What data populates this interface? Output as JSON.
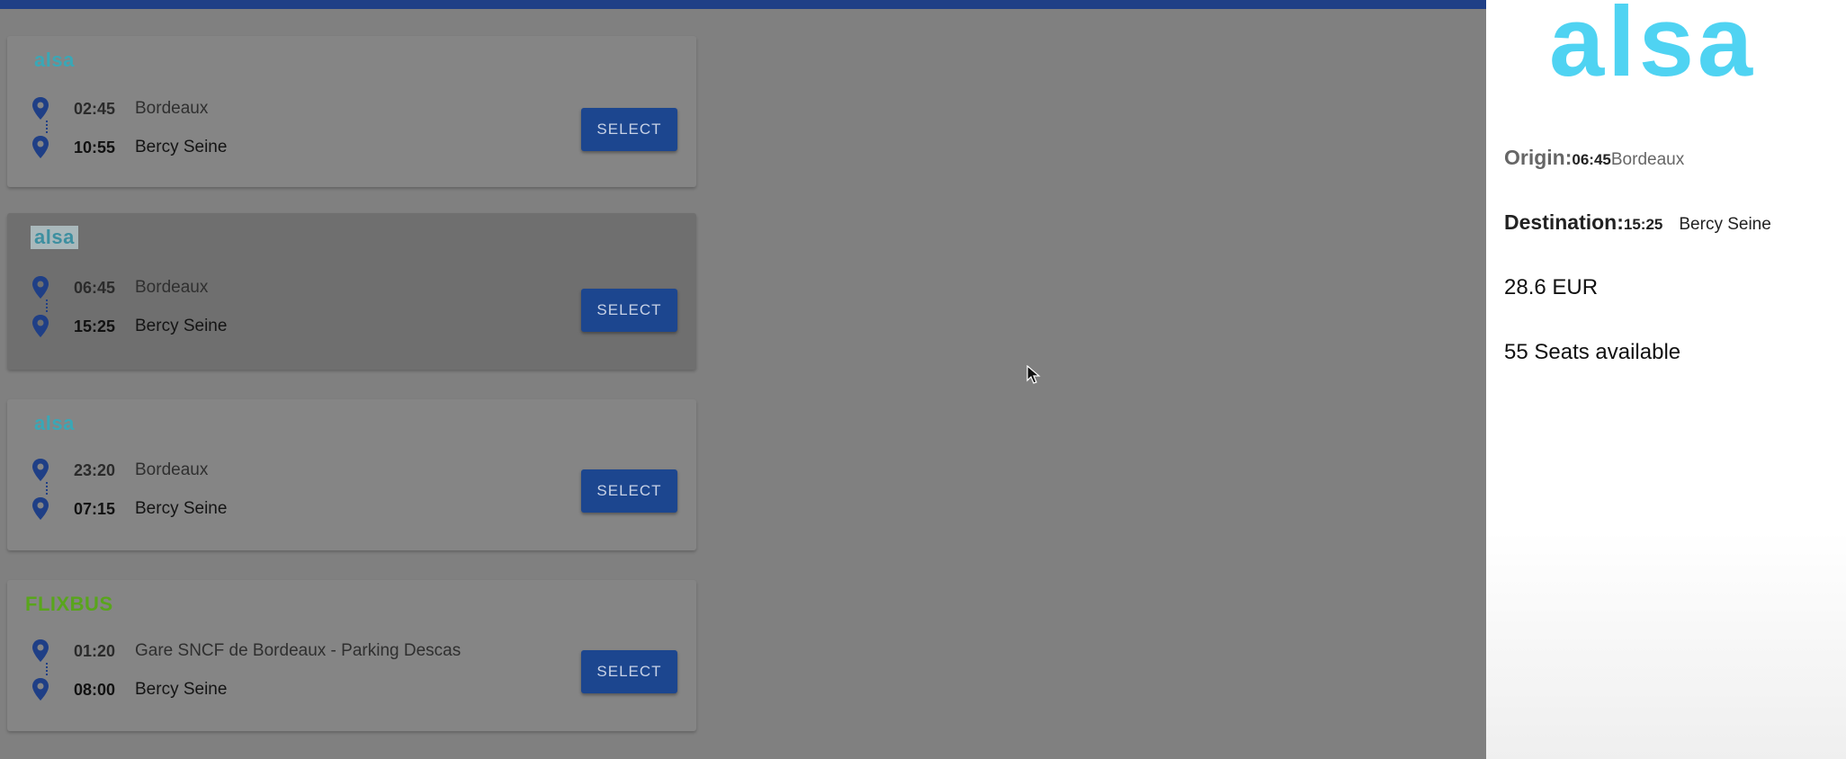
{
  "results": [
    {
      "operator": "alsa",
      "origin": {
        "time": "02:45",
        "place": "Bordeaux"
      },
      "destination": {
        "time": "10:55",
        "place": "Bercy Seine"
      },
      "button": "SELECT"
    },
    {
      "operator": "alsa",
      "origin": {
        "time": "06:45",
        "place": "Bordeaux"
      },
      "destination": {
        "time": "15:25",
        "place": "Bercy Seine"
      },
      "button": "SELECT"
    },
    {
      "operator": "alsa",
      "origin": {
        "time": "23:20",
        "place": "Bordeaux"
      },
      "destination": {
        "time": "07:15",
        "place": "Bercy Seine"
      },
      "button": "SELECT"
    },
    {
      "operator": "FLIXBUS",
      "origin": {
        "time": "01:20",
        "place": "Gare SNCF de Bordeaux - Parking Descas"
      },
      "destination": {
        "time": "08:00",
        "place": "Bercy Seine"
      },
      "button": "SELECT"
    }
  ],
  "details": {
    "logo": "alsa",
    "origin_label": "Origin:",
    "origin_time": "06:45",
    "origin_place": "Bordeaux",
    "destination_label": "Destination:",
    "destination_time": "15:25",
    "destination_place": "Bercy Seine",
    "price": "28.6 EUR",
    "seats": "55 Seats available"
  },
  "colors": {
    "primary": "#1c468f",
    "alsa_brand": "#4fd3f2",
    "flixbus_brand": "#59a51c"
  },
  "icons": [
    "location-pin-icon",
    "mouse-cursor-icon"
  ]
}
